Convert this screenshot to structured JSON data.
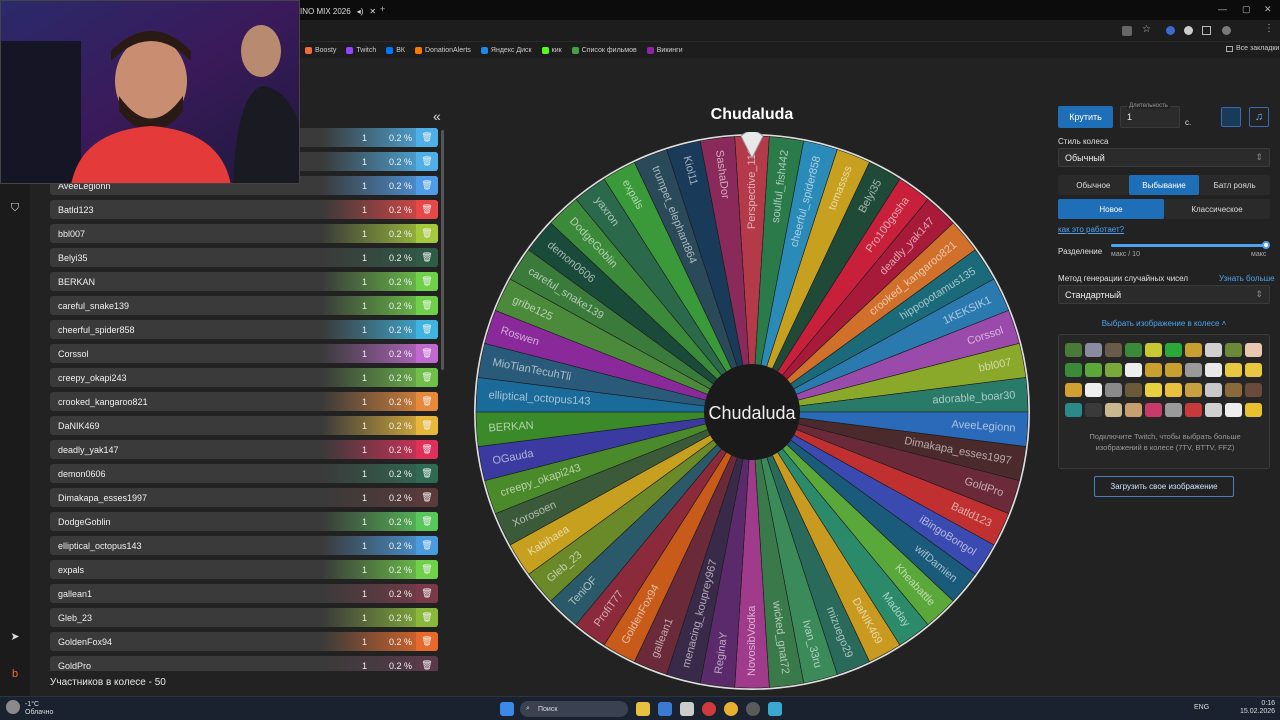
{
  "browser": {
    "tab_title": "INO MIX 2026",
    "bookmarks": [
      {
        "label": "Boosty",
        "color": "#f26b3a"
      },
      {
        "label": "Twitch",
        "color": "#9146ff"
      },
      {
        "label": "ВК",
        "color": "#0077ff"
      },
      {
        "label": "DonationAlerts",
        "color": "#f57c00"
      },
      {
        "label": "Яндекс Диск",
        "color": "#1e88e5"
      },
      {
        "label": "кик",
        "color": "#53fc18"
      },
      {
        "label": "Список фильмов",
        "color": "#43a047"
      },
      {
        "label": "Викинги",
        "color": "#8e24aa"
      }
    ],
    "all_bookmarks": "Все закладки"
  },
  "list": {
    "collapse_icon": "«",
    "delete_icon": "trash-icon",
    "items": [
      {
        "name": "",
        "count": "1",
        "pct": "0.2 %",
        "color": "#4fb0e8"
      },
      {
        "name": "",
        "count": "1",
        "pct": "0.2 %",
        "color": "#4fb0e8"
      },
      {
        "name": "AveeLegionn",
        "count": "1",
        "pct": "0.2 %",
        "color": "#4f9ce8"
      },
      {
        "name": "Batld123",
        "count": "1",
        "pct": "0.2 %",
        "color": "#e84747"
      },
      {
        "name": "bbl007",
        "count": "1",
        "pct": "0.2 %",
        "color": "#a4c93a"
      },
      {
        "name": "Belyi35",
        "count": "1",
        "pct": "0.2 %",
        "color": "#2f5b47"
      },
      {
        "name": "BERKAN",
        "count": "1",
        "pct": "0.2 %",
        "color": "#6fd04a"
      },
      {
        "name": "careful_snake139",
        "count": "1",
        "pct": "0.2 %",
        "color": "#6fd04a"
      },
      {
        "name": "cheerful_spider858",
        "count": "1",
        "pct": "0.2 %",
        "color": "#3eb4e0"
      },
      {
        "name": "Corssol",
        "count": "1",
        "pct": "0.2 %",
        "color": "#c06ad0"
      },
      {
        "name": "creepy_okapi243",
        "count": "1",
        "pct": "0.2 %",
        "color": "#6fbf4a"
      },
      {
        "name": "crooked_kangaroo821",
        "count": "1",
        "pct": "0.2 %",
        "color": "#e8893a"
      },
      {
        "name": "DaNIK469",
        "count": "1",
        "pct": "0.2 %",
        "color": "#e8b83a"
      },
      {
        "name": "deadly_yak147",
        "count": "1",
        "pct": "0.2 %",
        "color": "#e0305a"
      },
      {
        "name": "demon0606",
        "count": "1",
        "pct": "0.2 %",
        "color": "#2f6b52"
      },
      {
        "name": "Dimakapa_esses1997",
        "count": "1",
        "pct": "0.2 %",
        "color": "#5a3a3a"
      },
      {
        "name": "DodgeGoblin",
        "count": "1",
        "pct": "0.2 %",
        "color": "#58c85a"
      },
      {
        "name": "elliptical_octopus143",
        "count": "1",
        "pct": "0.2 %",
        "color": "#4a9ce0"
      },
      {
        "name": "expals",
        "count": "1",
        "pct": "0.2 %",
        "color": "#6fd04a"
      },
      {
        "name": "gallean1",
        "count": "1",
        "pct": "0.2 %",
        "color": "#7a3a4a"
      },
      {
        "name": "Gleb_23",
        "count": "1",
        "pct": "0.2 %",
        "color": "#8ab83a"
      },
      {
        "name": "GoldenFox94",
        "count": "1",
        "pct": "0.2 %",
        "color": "#e86a2a"
      },
      {
        "name": "GoldPro",
        "count": "1",
        "pct": "0.2 %",
        "color": "#5a3a4a"
      }
    ],
    "participants_label": "Участников в колесе - 50"
  },
  "wheel": {
    "title": "Chudaluda",
    "center": "Chudaluda",
    "segments": [
      {
        "name": "Perspective_116",
        "color": "#b43a4a"
      },
      {
        "name": "soulful_fish442",
        "color": "#2a7a4a"
      },
      {
        "name": "cheerful_spider858",
        "color": "#2a8ab8"
      },
      {
        "name": "tomassss",
        "color": "#c8a020"
      },
      {
        "name": "Belyi35",
        "color": "#1f4a38"
      },
      {
        "name": "Pro100gosha",
        "color": "#c8203a"
      },
      {
        "name": "deadly_yak147",
        "color": "#a81a3a"
      },
      {
        "name": "crooked_kangaroo821",
        "color": "#d0702a"
      },
      {
        "name": "hippopotamus135",
        "color": "#1a6a7a"
      },
      {
        "name": "1KEKSIK1",
        "color": "#2a7ab0"
      },
      {
        "name": "Corssol",
        "color": "#9a4aaa"
      },
      {
        "name": "bbl007",
        "color": "#8aa82a"
      },
      {
        "name": "adorable_boar30",
        "color": "#2a7a6a"
      },
      {
        "name": "AveeLegionn",
        "color": "#2a6ab8"
      },
      {
        "name": "Dimakapa_esses1997",
        "color": "#4a2a2a"
      },
      {
        "name": "GoldPro",
        "color": "#6a2a3a"
      },
      {
        "name": "Batld123",
        "color": "#c03030"
      },
      {
        "name": "iBingoBongol",
        "color": "#3a4ab0"
      },
      {
        "name": "wifDamien",
        "color": "#1a5a7a"
      },
      {
        "name": "Kheabattle",
        "color": "#5aa83a"
      },
      {
        "name": "Madday",
        "color": "#2a8a6a"
      },
      {
        "name": "DaNIK469",
        "color": "#c89a20"
      },
      {
        "name": "mizuego29",
        "color": "#2a6a5a"
      },
      {
        "name": "Ivan_33ru",
        "color": "#3a8a5a"
      },
      {
        "name": "wicked_gnat72",
        "color": "#3a7a4a"
      },
      {
        "name": "NovosibVodka",
        "color": "#a03a8a"
      },
      {
        "name": "ReginaY",
        "color": "#5a2a6a"
      },
      {
        "name": "menacing_kouprey967",
        "color": "#3a2a4a"
      },
      {
        "name": "gallean1",
        "color": "#6a2a3a"
      },
      {
        "name": "GoldenFox94",
        "color": "#c85a1a"
      },
      {
        "name": "ProfiT77",
        "color": "#8a2a3a"
      },
      {
        "name": "TeniOF",
        "color": "#2a5a6a"
      },
      {
        "name": "Gleb_23",
        "color": "#6a8a2a"
      },
      {
        "name": "Kabihaea",
        "color": "#c8a020"
      },
      {
        "name": "Xorosoen",
        "color": "#3a5a3a"
      },
      {
        "name": "creepy_okapi243",
        "color": "#4a8a2a"
      },
      {
        "name": "OGauda",
        "color": "#3a3aa0"
      },
      {
        "name": "BERKAN",
        "color": "#3a8a2a"
      },
      {
        "name": "elliptical_octopus143",
        "color": "#1a6a9a"
      },
      {
        "name": "MioTianTecuhTli",
        "color": "#2a5a7a"
      },
      {
        "name": "Roswen",
        "color": "#8a2a9a"
      },
      {
        "name": "gribe125",
        "color": "#4a8a3a"
      },
      {
        "name": "careful_snake139",
        "color": "#3a7a3a"
      },
      {
        "name": "demon0606",
        "color": "#1a4a3a"
      },
      {
        "name": "DodgeGoblin",
        "color": "#3a8a3a"
      },
      {
        "name": "yaxron",
        "color": "#2a6a4a"
      },
      {
        "name": "expals",
        "color": "#3a9a3a"
      },
      {
        "name": "trumpet_elephant864",
        "color": "#2a4a5a"
      },
      {
        "name": "Kiol11",
        "color": "#1a3a5a"
      },
      {
        "name": "SashaDor",
        "color": "#8a2a5a"
      }
    ]
  },
  "controls": {
    "spin_label": "Крутить",
    "duration_label": "Длительность",
    "duration_value": "1",
    "duration_unit": "с.",
    "style_label": "Стиль колеса",
    "style_value": "Обычный",
    "mode_tabs": [
      "Обычное",
      "Выбывание",
      "Батл рояль"
    ],
    "mode_selected": 1,
    "sub_tabs": [
      "Новое",
      "Классическое"
    ],
    "sub_selected": 0,
    "how_link": "как это работает?",
    "split_label": "Разделение",
    "split_min": "макс / 10",
    "split_max": "макс",
    "split_fraction": 1.0,
    "rng_label": "Метод генерации случайных чисел",
    "rng_learn": "Узнать больше",
    "rng_value": "Стандартный",
    "image_toggle": "Выбрать изображение в колесе",
    "twitch_note": "Подключите Twitch, чтобы выбрать больше изображений в колесе (7TV, BTTV, FFZ)",
    "upload_label": "Загрузить свое изображение"
  },
  "emote_colors": [
    "#4a7a3a",
    "#8a8aa0",
    "#6a5a4a",
    "#3a8a3a",
    "#c8c830",
    "#2aa83a",
    "#c8a030",
    "#d0d0d0",
    "#6a8a3a",
    "#e8c8b0",
    "#3a8a3a",
    "#5aa83a",
    "#7aa83a",
    "#eeeeee",
    "#c8a030",
    "#c8a030",
    "#9a9a9a",
    "#e8e8e8",
    "#e8c840",
    "#e8c840",
    "#d0a030",
    "#eeeeee",
    "#8a8a8a",
    "#6a5a3a",
    "#e8d040",
    "#e8c040",
    "#c8a040",
    "#c8c8c8",
    "#8a6a3a",
    "#6a4a3a",
    "#2a8a8a",
    "#3a3a3a",
    "#c8b890",
    "#c8a070",
    "#c83a6a",
    "#9a9a9a",
    "#c83a3a",
    "#d0d0d0",
    "#eeeeee",
    "#e8c030"
  ],
  "taskbar": {
    "weather_temp": "-1°C",
    "weather_text": "Облачно",
    "search_label": "Поиск",
    "lang": "ENG",
    "time": "0:16",
    "date": "15.02.2026"
  }
}
